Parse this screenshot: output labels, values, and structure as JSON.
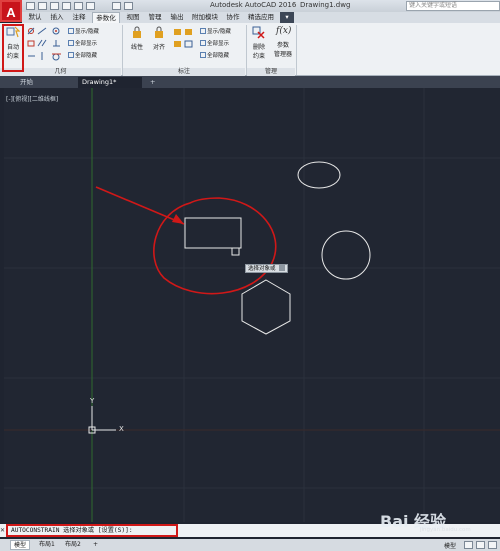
{
  "app": {
    "logo_letter": "A",
    "title": "Autodesk AutoCAD 2016",
    "file": "Drawing1.dwg",
    "search_placeholder": "键入关键字或短语"
  },
  "ribbon": {
    "tabs": [
      "默认",
      "插入",
      "注释",
      "参数化",
      "视图",
      "管理",
      "输出",
      "附加模块",
      "协作",
      "精选应用"
    ],
    "active_tab": "参数化",
    "groups": {
      "geometric": {
        "label": "几何",
        "auto_constrain": [
          "自动",
          "约束"
        ],
        "show_hide": "显示/隐藏",
        "show_all": "全部显示",
        "hide_all": "全部隐藏"
      },
      "dimensional": {
        "label": "标注",
        "linear": "线性",
        "aligned": "对齐",
        "show_hide": "显示/隐藏",
        "show_all": "全部显示",
        "hide_all": "全部隐藏"
      },
      "manage": {
        "label": "管理",
        "delete_constraints": [
          "删除",
          "约束"
        ],
        "parameters_manager": [
          "参数",
          "管理器"
        ],
        "fx": "f(x)"
      }
    }
  },
  "doc_tabs": {
    "start": "开始",
    "drawing": "Drawing1*",
    "add": "+"
  },
  "viewport": {
    "label": "[-][俯视][二维线框]",
    "ucs_x": "X",
    "ucs_y": "Y"
  },
  "tooltip": {
    "text": "选择对象或"
  },
  "command_line": {
    "text": "AUTOCONSTRAIN 选择对象或 [设置(S)]:"
  },
  "layout_tabs": {
    "model": "模型",
    "layout1": "布局1",
    "layout2": "布局2",
    "add": "+"
  },
  "status": {
    "model": "模型"
  },
  "watermark": {
    "brand": "Bai 经验",
    "url": "jingyan.baidu.com"
  },
  "colors": {
    "annotation_red": "#d01818",
    "viewport_bg": "#212632",
    "geometry": "#e8e8e8",
    "ucs_green": "#2f6b2f"
  }
}
